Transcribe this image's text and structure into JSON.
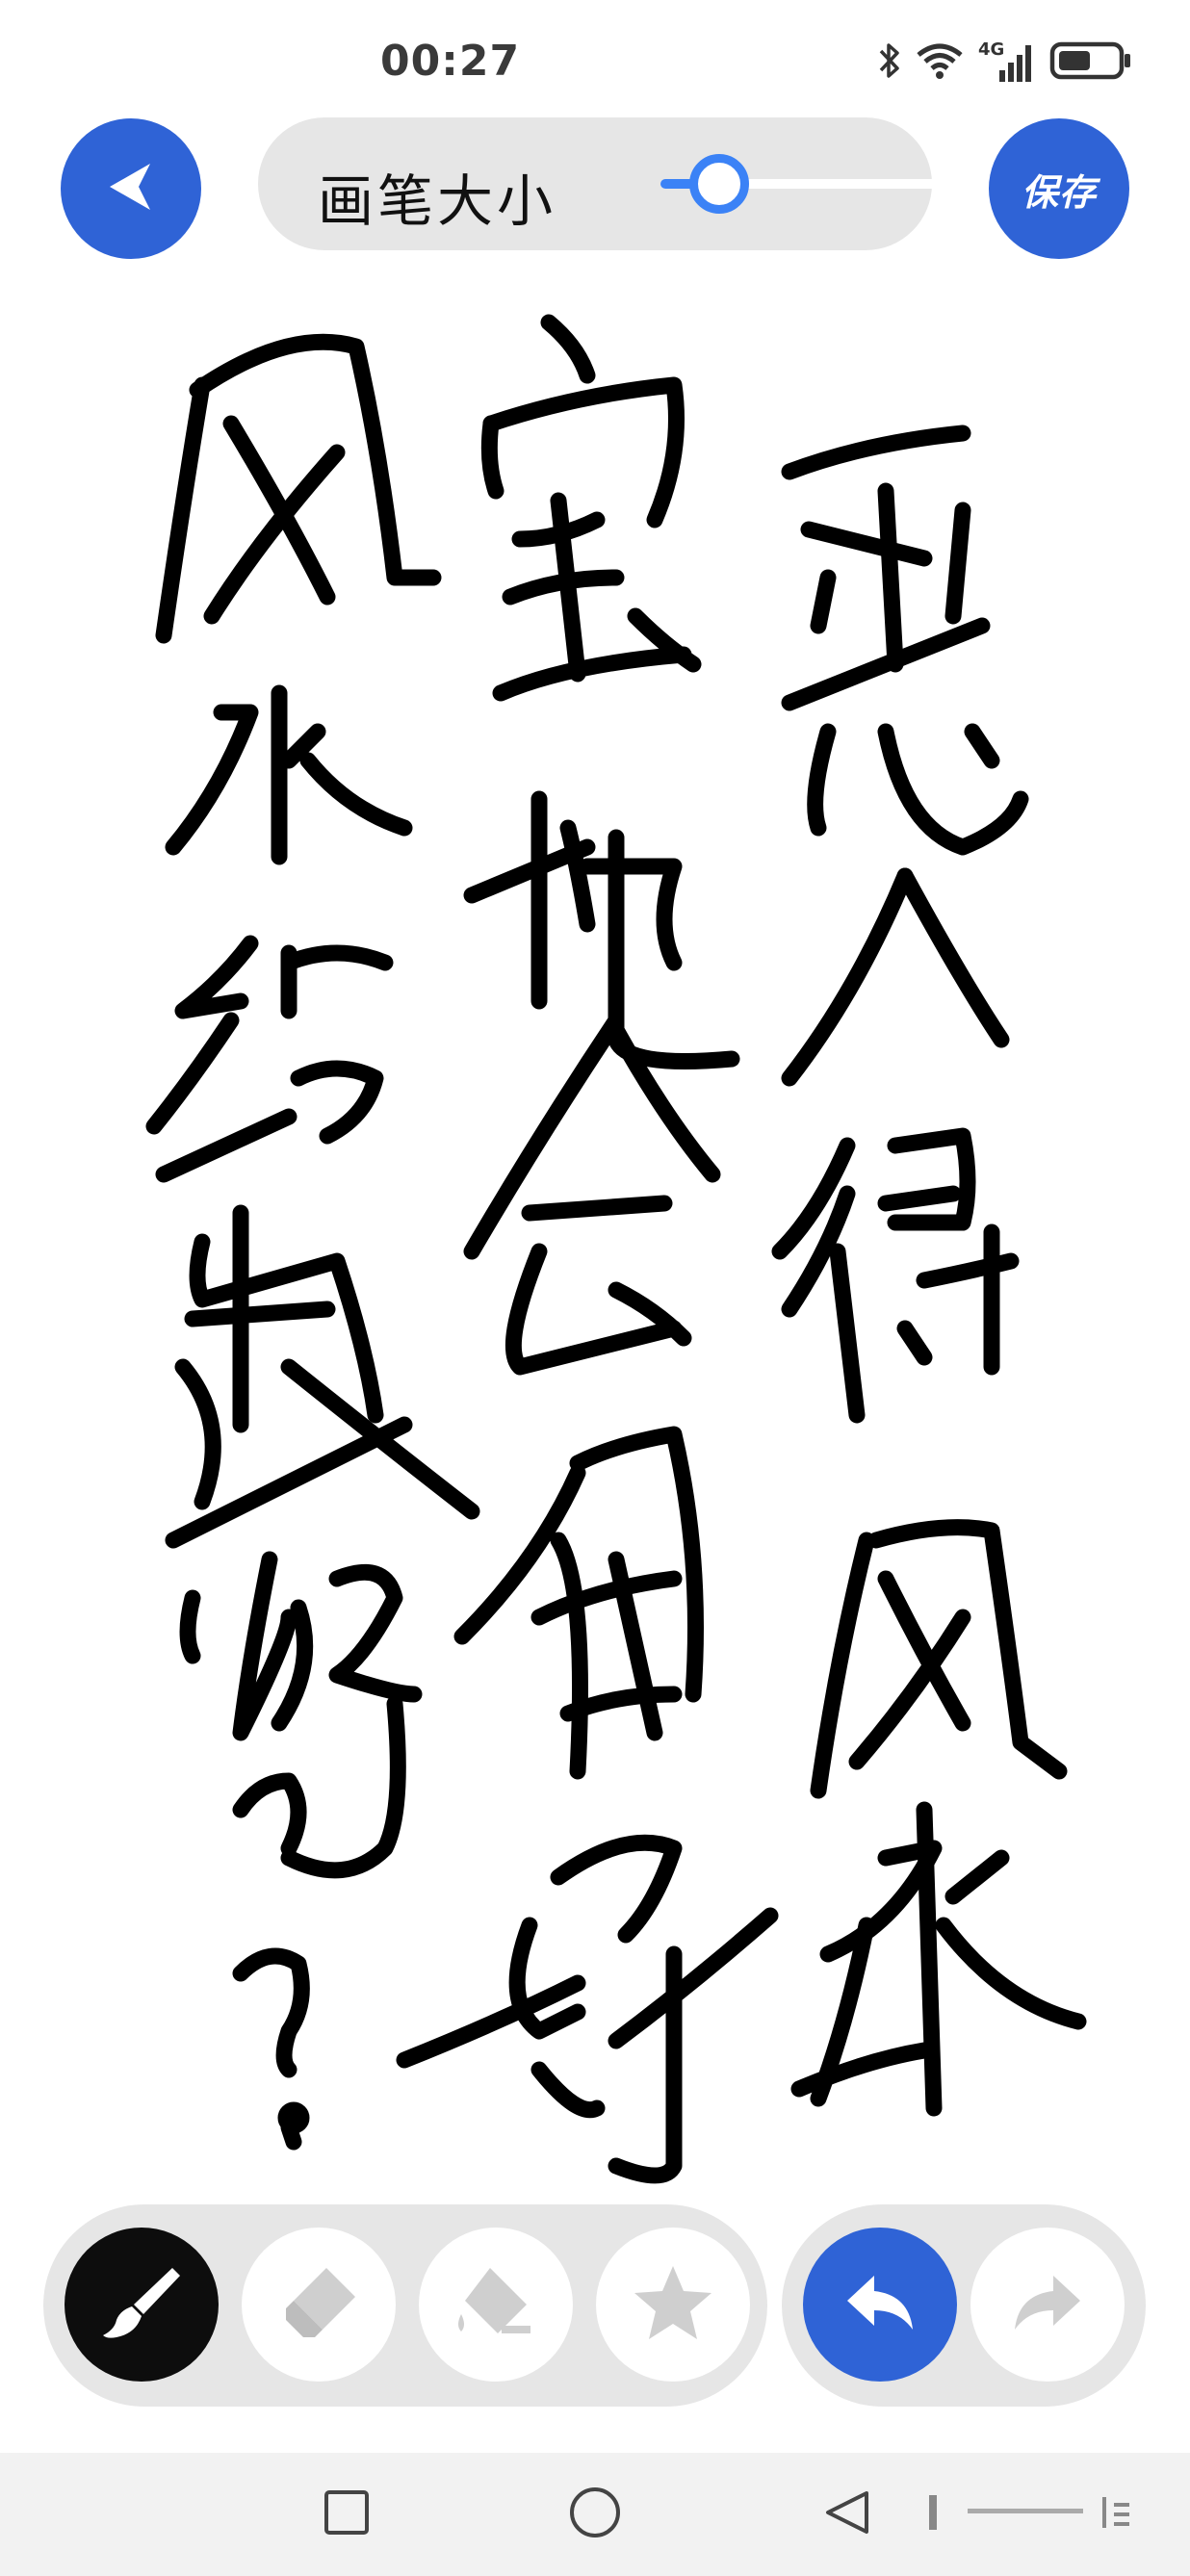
{
  "status_bar": {
    "time": "00:27",
    "network_label": "4G",
    "icons": [
      "bluetooth-icon",
      "wifi-icon",
      "signal-4g-icon",
      "battery-icon"
    ]
  },
  "toolbar": {
    "back_icon": "back-icon",
    "brush_size_label": "画笔大小",
    "brush_size_level": 0.2,
    "save_label": "保存",
    "accent_color": "#2f63d6",
    "slider_color": "#3b82f6"
  },
  "canvas": {
    "content": "handwritten strokes",
    "ink_color": "#000000",
    "background_color": "#ffffff"
  },
  "tools": [
    {
      "name": "brush",
      "icon": "brush-icon",
      "selected": true
    },
    {
      "name": "eraser",
      "icon": "eraser-icon",
      "selected": false
    },
    {
      "name": "fill",
      "icon": "paint-bucket-icon",
      "selected": false
    },
    {
      "name": "stamp",
      "icon": "star-icon",
      "selected": false
    }
  ],
  "history": [
    {
      "name": "undo",
      "icon": "undo-icon",
      "enabled": true
    },
    {
      "name": "redo",
      "icon": "redo-icon",
      "enabled": false
    }
  ],
  "nav_bar": {
    "items": [
      "recents-square-icon",
      "home-circle-icon",
      "back-triangle-icon",
      "menu-icon"
    ]
  }
}
